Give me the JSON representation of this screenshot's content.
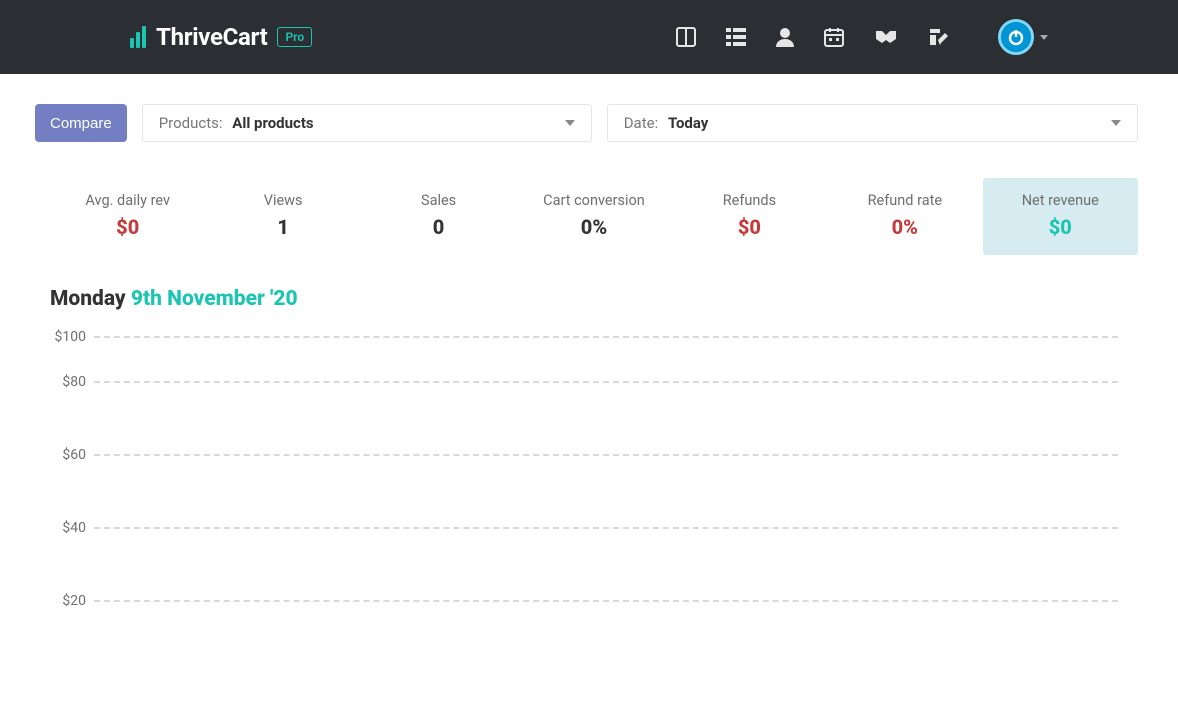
{
  "brand": {
    "name": "ThriveCart",
    "badge": "Pro"
  },
  "nav_icons": [
    "dashboard",
    "list",
    "user",
    "calendar",
    "handshake",
    "edit"
  ],
  "filters": {
    "compare_label": "Compare",
    "products_label": "Products:",
    "products_value": "All products",
    "date_label": "Date:",
    "date_value": "Today"
  },
  "stats": [
    {
      "label": "Avg. daily rev",
      "value": "$0",
      "cls": "val-red",
      "active": false
    },
    {
      "label": "Views",
      "value": "1",
      "cls": "val-dark",
      "active": false
    },
    {
      "label": "Sales",
      "value": "0",
      "cls": "val-dark",
      "active": false
    },
    {
      "label": "Cart conversion",
      "value": "0%",
      "cls": "val-dark",
      "active": false
    },
    {
      "label": "Refunds",
      "value": "$0",
      "cls": "val-red",
      "active": false
    },
    {
      "label": "Refund rate",
      "value": "0%",
      "cls": "val-red",
      "active": false
    },
    {
      "label": "Net revenue",
      "value": "$0",
      "cls": "val-teal",
      "active": true
    }
  ],
  "date_heading": {
    "day": "Monday ",
    "rest": "9th November '20"
  },
  "chart_data": {
    "type": "line",
    "title": "Net revenue",
    "xlabel": "",
    "ylabel": "",
    "ylim": [
      0,
      100
    ],
    "y_ticks": [
      "$100",
      "$80",
      "$60",
      "$40",
      "$20"
    ],
    "categories": [],
    "series": [
      {
        "name": "Net revenue",
        "values": []
      }
    ]
  }
}
